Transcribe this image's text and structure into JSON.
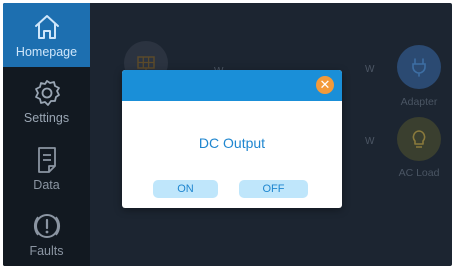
{
  "sidebar": {
    "items": [
      {
        "label": "Homepage",
        "icon": "home-icon"
      },
      {
        "label": "Settings",
        "icon": "gear-icon"
      },
      {
        "label": "Data",
        "icon": "document-icon"
      },
      {
        "label": "Faults",
        "icon": "alert-icon"
      }
    ]
  },
  "main": {
    "solar_unit": "W",
    "adapter_unit": "W",
    "adapter_label": "Adapter",
    "acload_unit": "W",
    "acload_label": "AC Load"
  },
  "dialog": {
    "title": "DC Output",
    "on_label": "ON",
    "off_label": "OFF",
    "close_icon": "close-icon"
  },
  "colors": {
    "accent": "#1a8fd8",
    "close": "#f39a3a",
    "active_sidebar": "#1d6fb0",
    "button_bg": "#bfe6fb"
  }
}
